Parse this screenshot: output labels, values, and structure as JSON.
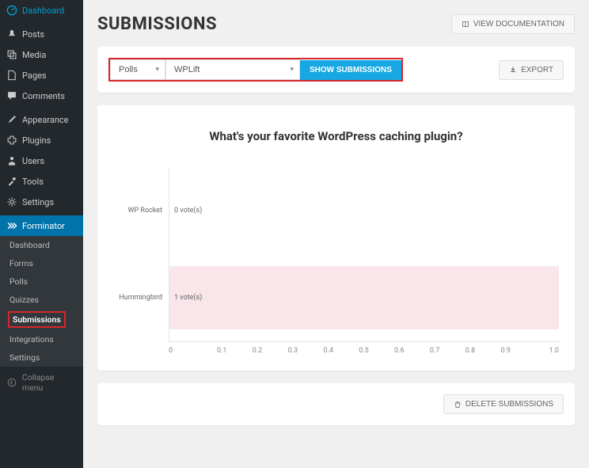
{
  "sidebar": {
    "items": [
      {
        "icon": "dashboard",
        "label": "Dashboard"
      },
      {
        "icon": "pin",
        "label": "Posts"
      },
      {
        "icon": "media",
        "label": "Media"
      },
      {
        "icon": "page",
        "label": "Pages"
      },
      {
        "icon": "comment",
        "label": "Comments"
      },
      {
        "icon": "brush",
        "label": "Appearance"
      },
      {
        "icon": "plugin",
        "label": "Plugins"
      },
      {
        "icon": "user",
        "label": "Users"
      },
      {
        "icon": "wrench",
        "label": "Tools"
      },
      {
        "icon": "gear",
        "label": "Settings"
      },
      {
        "icon": "forminator",
        "label": "Forminator"
      }
    ],
    "submenu": [
      "Dashboard",
      "Forms",
      "Polls",
      "Quizzes",
      "Submissions",
      "Integrations",
      "Settings"
    ],
    "collapse": "Collapse menu"
  },
  "header": {
    "title": "SUBMISSIONS",
    "doc_btn": "VIEW DOCUMENTATION"
  },
  "filters": {
    "type": "Polls",
    "item": "WPLift",
    "show_btn": "SHOW SUBMISSIONS",
    "export_btn": "EXPORT"
  },
  "chart_data": {
    "type": "bar",
    "title": "What's your favorite WordPress caching plugin?",
    "categories": [
      "WP Rocket",
      "Hummingbird"
    ],
    "values": [
      0,
      1
    ],
    "value_labels": [
      "0 vote(s)",
      "1 vote(s)"
    ],
    "xticks": [
      "0",
      "0.1",
      "0.2",
      "0.3",
      "0.4",
      "0.5",
      "0.6",
      "0.7",
      "0.8",
      "0.9",
      "1.0"
    ],
    "xlim": [
      0,
      1
    ]
  },
  "footer": {
    "delete_btn": "DELETE SUBMISSIONS"
  }
}
